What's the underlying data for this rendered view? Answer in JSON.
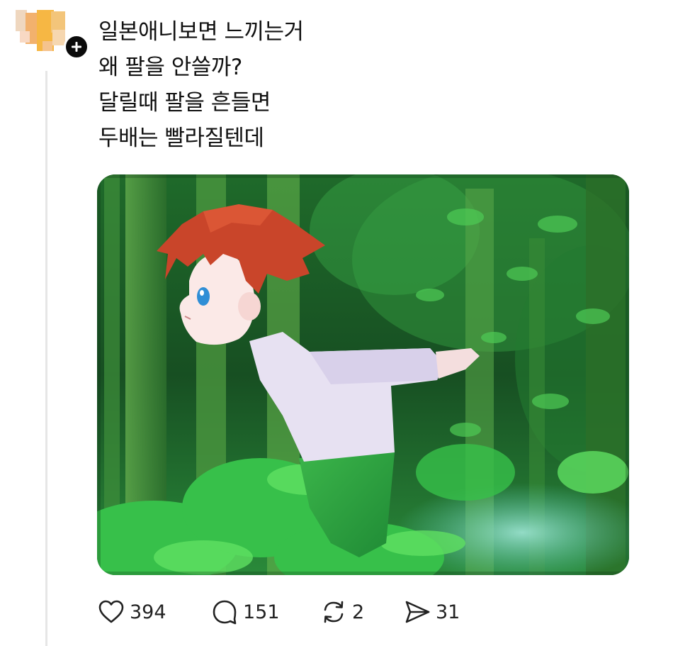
{
  "post": {
    "lines": [
      "일본애니보면 느끼는거",
      "왜 팔을 안쓸까?",
      "달릴때 팔을 흔들면",
      "두배는 빨라질텐데"
    ]
  },
  "media": {
    "icon": "anime-boy-running-forest-image"
  },
  "actions": {
    "like_count": "394",
    "reply_count": "151",
    "repost_count": "2",
    "share_count": "31"
  },
  "icons": {
    "follow": "plus-icon",
    "like": "heart-icon",
    "reply": "speech-bubble-icon",
    "repost": "repost-arrows-icon",
    "share": "send-arrow-icon"
  },
  "colors": {
    "text": "#111111",
    "badge": "#0b0b0b",
    "thread_line": "#e6e6e6"
  }
}
